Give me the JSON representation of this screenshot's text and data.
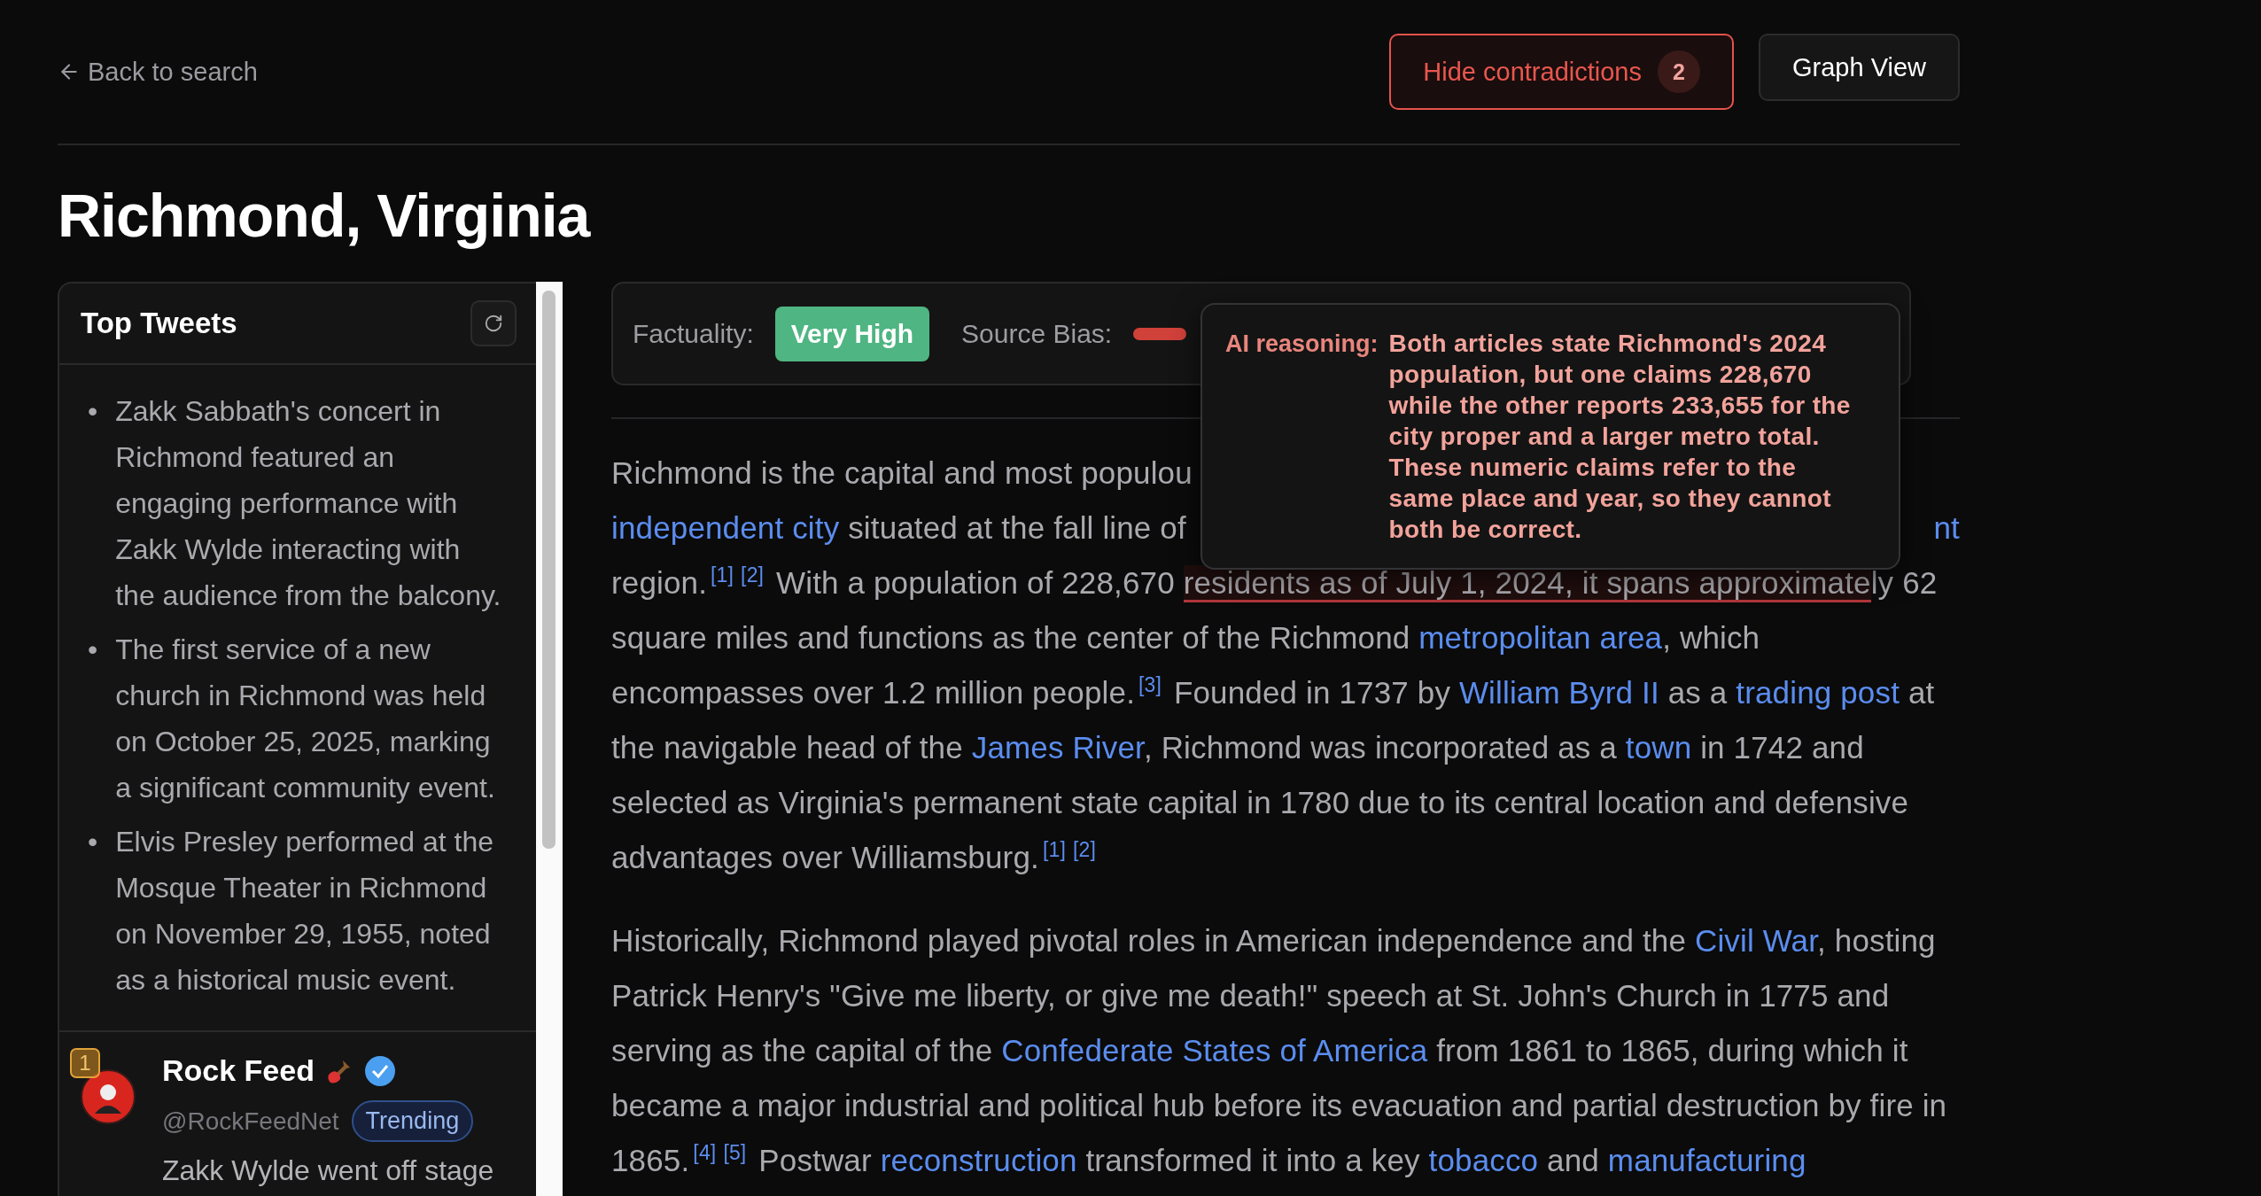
{
  "nav": {
    "back": "Back to search"
  },
  "actions": [
    {
      "kind": "contradictions",
      "label": "Hide contradictions",
      "count": "2"
    },
    {
      "kind": "plain",
      "label": "Graph View"
    }
  ],
  "title": "Richmond, Virginia",
  "sidebar": {
    "title": "Top Tweets",
    "bullets": [
      {
        "marker": "•",
        "text": "Zakk Sabbath's concert in Richmond featured an engaging performance with Zakk Wylde interacting with the audience from the balcony."
      },
      {
        "marker": "•",
        "text": "The first service of a new church in Richmond was held on October 25, 2025, marking a significant community event."
      },
      {
        "marker": "•",
        "text": "Elvis Presley performed at the Mosque Theater in Richmond on November 29, 1955, noted as a historical music event."
      }
    ],
    "tweets": [
      {
        "rank": "1",
        "name": "Rock Feed",
        "verified": true,
        "handle": "@RockFeedNet",
        "tag": "Trending",
        "text": "Zakk Wylde went off stage"
      }
    ]
  },
  "ratings": {
    "factuality_label": "Factuality:",
    "factuality": "Very High",
    "bias_label": "Source Bias:"
  },
  "tooltip": {
    "label": "AI reasoning:",
    "text": "Both articles state Richmond's 2024 population, but one claims 228,670 while the other reports 233,655 for the city proper and a larger metro total. These numeric claims refer to the same place and year, so they cannot both be correct."
  },
  "article": {
    "paragraphs": [
      {
        "lines": [
          {
            "left": [
              {
                "kind": "plain",
                "text": "Richmond is the capital and most populou"
              }
            ]
          },
          {
            "left": [
              {
                "kind": "link",
                "text": "independent city"
              },
              {
                "kind": "plain",
                "text": " situated at the fall line of"
              }
            ],
            "right": [
              {
                "kind": "link",
                "text": "nt"
              }
            ]
          }
        ],
        "segments": [
          {
            "kind": "plain",
            "text": "region."
          },
          {
            "kind": "cite",
            "text": "[1]"
          },
          {
            "kind": "cite",
            "text": "[2]"
          },
          {
            "kind": "plain",
            "text": " With a population of 228,670 "
          },
          {
            "kind": "contradiction",
            "text": "residents as of July 1, 2024, it spans approximate"
          },
          {
            "kind": "plain",
            "text": "ly 62 square miles and functions as the center of the Richmond "
          },
          {
            "kind": "link",
            "text": "metropolitan area"
          },
          {
            "kind": "plain",
            "text": ", which encompasses over 1.2 million people."
          },
          {
            "kind": "cite",
            "text": "[3]"
          },
          {
            "kind": "plain",
            "text": " Founded in 1737 by "
          },
          {
            "kind": "link",
            "text": "William Byrd II"
          },
          {
            "kind": "plain",
            "text": " as a "
          },
          {
            "kind": "link",
            "text": "trading post"
          },
          {
            "kind": "plain",
            "text": " at the navigable head of the "
          },
          {
            "kind": "link",
            "text": "James River"
          },
          {
            "kind": "plain",
            "text": ", Richmond was incorporated as a "
          },
          {
            "kind": "link",
            "text": "town"
          },
          {
            "kind": "plain",
            "text": " in 1742 and selected as Virginia's permanent state capital in 1780 due to its central location and defensive advantages over Williamsburg."
          },
          {
            "kind": "cite",
            "text": "[1]"
          },
          {
            "kind": "cite",
            "text": "[2]"
          }
        ]
      },
      {
        "segments": [
          {
            "kind": "plain",
            "text": "Historically, Richmond played pivotal roles in American independence and the "
          },
          {
            "kind": "link",
            "text": "Civil War"
          },
          {
            "kind": "plain",
            "text": ", hosting Patrick Henry's \"Give me liberty, or give me death!\" speech at St. John's Church in 1775 and serving as the capital of the "
          },
          {
            "kind": "link",
            "text": "Confederate States of America"
          },
          {
            "kind": "plain",
            "text": " from 1861 to 1865, during which it became a major industrial and political hub before its evacuation and partial destruction by fire in 1865."
          },
          {
            "kind": "cite",
            "text": "[4]"
          },
          {
            "kind": "cite",
            "text": "[5]"
          },
          {
            "kind": "plain",
            "text": " Postwar "
          },
          {
            "kind": "link",
            "text": "reconstruction"
          },
          {
            "kind": "plain",
            "text": " transformed it into a key "
          },
          {
            "kind": "link",
            "text": "tobacco"
          },
          {
            "kind": "plain",
            "text": " and "
          },
          {
            "kind": "link",
            "text": "manufacturing"
          }
        ]
      }
    ]
  }
}
